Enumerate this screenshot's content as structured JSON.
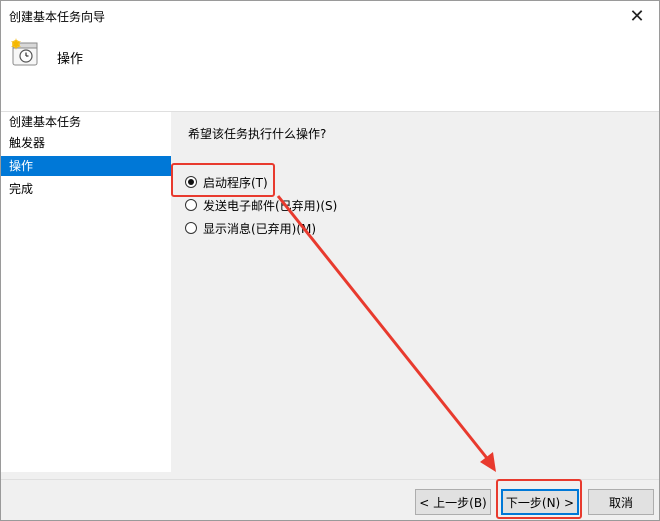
{
  "window": {
    "title": "创建基本任务向导",
    "close_glyph": "✕"
  },
  "header": {
    "title": "操作",
    "icon": "clock-task-icon"
  },
  "nav": {
    "items": [
      {
        "label": "创建基本任务",
        "selected": false
      },
      {
        "label": "触发器",
        "selected": false
      },
      {
        "label": "操作",
        "selected": true
      },
      {
        "label": "完成",
        "selected": false
      }
    ]
  },
  "content": {
    "prompt": "希望该任务执行什么操作?",
    "options": [
      {
        "label": "启动程序(T)",
        "selected": true
      },
      {
        "label": "发送电子邮件(已弃用)(S)",
        "selected": false
      },
      {
        "label": "显示消息(已弃用)(M)",
        "selected": false
      }
    ]
  },
  "buttons": {
    "back": "< 上一步(B)",
    "next": "下一步(N) >",
    "cancel": "取消"
  },
  "colors": {
    "selection": "#0078d7",
    "annotation": "#e83a2e"
  }
}
